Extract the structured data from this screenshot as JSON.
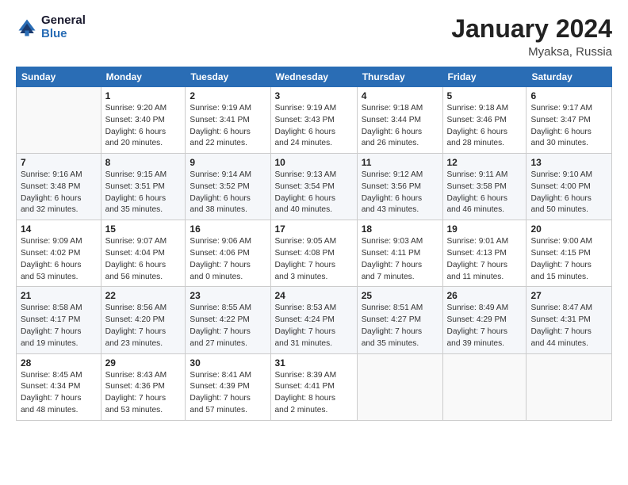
{
  "header": {
    "logo_general": "General",
    "logo_blue": "Blue",
    "month_year": "January 2024",
    "location": "Myaksa, Russia"
  },
  "days_of_week": [
    "Sunday",
    "Monday",
    "Tuesday",
    "Wednesday",
    "Thursday",
    "Friday",
    "Saturday"
  ],
  "weeks": [
    [
      {
        "num": "",
        "detail": ""
      },
      {
        "num": "1",
        "detail": "Sunrise: 9:20 AM\nSunset: 3:40 PM\nDaylight: 6 hours\nand 20 minutes."
      },
      {
        "num": "2",
        "detail": "Sunrise: 9:19 AM\nSunset: 3:41 PM\nDaylight: 6 hours\nand 22 minutes."
      },
      {
        "num": "3",
        "detail": "Sunrise: 9:19 AM\nSunset: 3:43 PM\nDaylight: 6 hours\nand 24 minutes."
      },
      {
        "num": "4",
        "detail": "Sunrise: 9:18 AM\nSunset: 3:44 PM\nDaylight: 6 hours\nand 26 minutes."
      },
      {
        "num": "5",
        "detail": "Sunrise: 9:18 AM\nSunset: 3:46 PM\nDaylight: 6 hours\nand 28 minutes."
      },
      {
        "num": "6",
        "detail": "Sunrise: 9:17 AM\nSunset: 3:47 PM\nDaylight: 6 hours\nand 30 minutes."
      }
    ],
    [
      {
        "num": "7",
        "detail": "Sunrise: 9:16 AM\nSunset: 3:48 PM\nDaylight: 6 hours\nand 32 minutes."
      },
      {
        "num": "8",
        "detail": "Sunrise: 9:15 AM\nSunset: 3:51 PM\nDaylight: 6 hours\nand 35 minutes."
      },
      {
        "num": "9",
        "detail": "Sunrise: 9:14 AM\nSunset: 3:52 PM\nDaylight: 6 hours\nand 38 minutes."
      },
      {
        "num": "10",
        "detail": "Sunrise: 9:13 AM\nSunset: 3:54 PM\nDaylight: 6 hours\nand 40 minutes."
      },
      {
        "num": "11",
        "detail": "Sunrise: 9:12 AM\nSunset: 3:56 PM\nDaylight: 6 hours\nand 43 minutes."
      },
      {
        "num": "12",
        "detail": "Sunrise: 9:11 AM\nSunset: 3:58 PM\nDaylight: 6 hours\nand 46 minutes."
      },
      {
        "num": "13",
        "detail": "Sunrise: 9:10 AM\nSunset: 4:00 PM\nDaylight: 6 hours\nand 50 minutes."
      }
    ],
    [
      {
        "num": "14",
        "detail": "Sunrise: 9:09 AM\nSunset: 4:02 PM\nDaylight: 6 hours\nand 53 minutes."
      },
      {
        "num": "15",
        "detail": "Sunrise: 9:07 AM\nSunset: 4:04 PM\nDaylight: 6 hours\nand 56 minutes."
      },
      {
        "num": "16",
        "detail": "Sunrise: 9:06 AM\nSunset: 4:06 PM\nDaylight: 7 hours\nand 0 minutes."
      },
      {
        "num": "17",
        "detail": "Sunrise: 9:05 AM\nSunset: 4:08 PM\nDaylight: 7 hours\nand 3 minutes."
      },
      {
        "num": "18",
        "detail": "Sunrise: 9:03 AM\nSunset: 4:11 PM\nDaylight: 7 hours\nand 7 minutes."
      },
      {
        "num": "19",
        "detail": "Sunrise: 9:01 AM\nSunset: 4:13 PM\nDaylight: 7 hours\nand 11 minutes."
      },
      {
        "num": "20",
        "detail": "Sunrise: 9:00 AM\nSunset: 4:15 PM\nDaylight: 7 hours\nand 15 minutes."
      }
    ],
    [
      {
        "num": "21",
        "detail": "Sunrise: 8:58 AM\nSunset: 4:17 PM\nDaylight: 7 hours\nand 19 minutes."
      },
      {
        "num": "22",
        "detail": "Sunrise: 8:56 AM\nSunset: 4:20 PM\nDaylight: 7 hours\nand 23 minutes."
      },
      {
        "num": "23",
        "detail": "Sunrise: 8:55 AM\nSunset: 4:22 PM\nDaylight: 7 hours\nand 27 minutes."
      },
      {
        "num": "24",
        "detail": "Sunrise: 8:53 AM\nSunset: 4:24 PM\nDaylight: 7 hours\nand 31 minutes."
      },
      {
        "num": "25",
        "detail": "Sunrise: 8:51 AM\nSunset: 4:27 PM\nDaylight: 7 hours\nand 35 minutes."
      },
      {
        "num": "26",
        "detail": "Sunrise: 8:49 AM\nSunset: 4:29 PM\nDaylight: 7 hours\nand 39 minutes."
      },
      {
        "num": "27",
        "detail": "Sunrise: 8:47 AM\nSunset: 4:31 PM\nDaylight: 7 hours\nand 44 minutes."
      }
    ],
    [
      {
        "num": "28",
        "detail": "Sunrise: 8:45 AM\nSunset: 4:34 PM\nDaylight: 7 hours\nand 48 minutes."
      },
      {
        "num": "29",
        "detail": "Sunrise: 8:43 AM\nSunset: 4:36 PM\nDaylight: 7 hours\nand 53 minutes."
      },
      {
        "num": "30",
        "detail": "Sunrise: 8:41 AM\nSunset: 4:39 PM\nDaylight: 7 hours\nand 57 minutes."
      },
      {
        "num": "31",
        "detail": "Sunrise: 8:39 AM\nSunset: 4:41 PM\nDaylight: 8 hours\nand 2 minutes."
      },
      {
        "num": "",
        "detail": ""
      },
      {
        "num": "",
        "detail": ""
      },
      {
        "num": "",
        "detail": ""
      }
    ]
  ]
}
